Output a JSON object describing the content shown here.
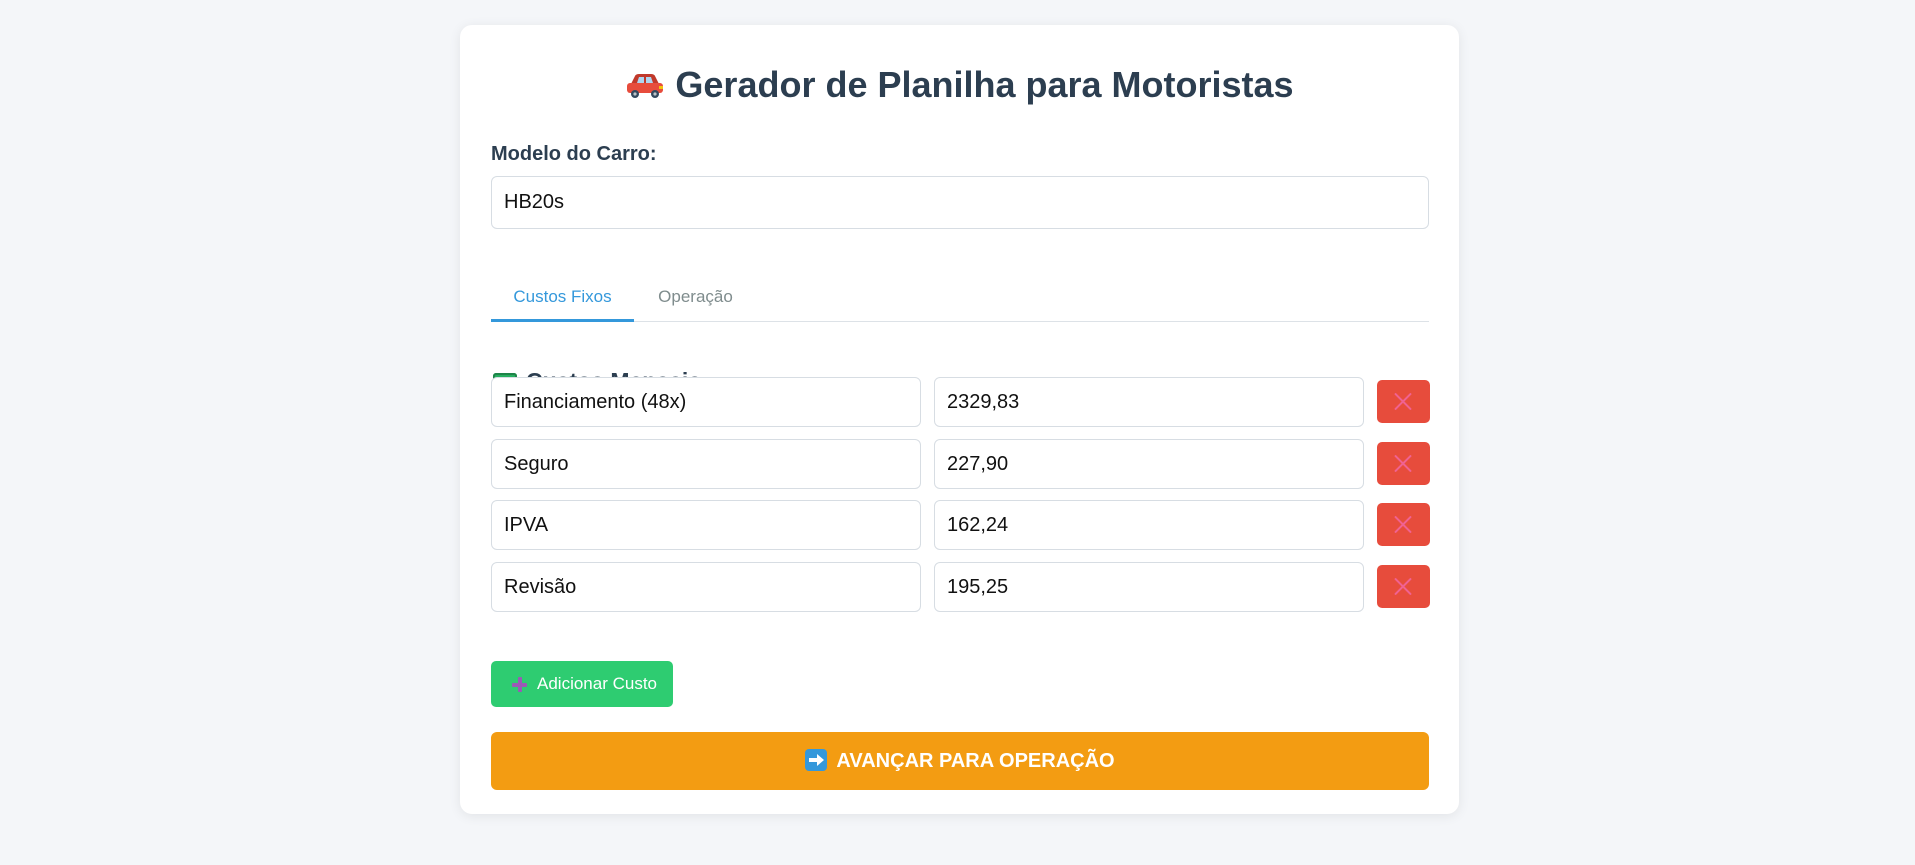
{
  "header": {
    "title": "Gerador de Planilha para Motoristas",
    "title_icon": "car-icon"
  },
  "car": {
    "label": "Modelo do Carro:",
    "value": "HB20s"
  },
  "tabs": [
    {
      "label": "Custos Fixos",
      "active": true
    },
    {
      "label": "Operação",
      "active": false
    }
  ],
  "section": {
    "title": "Custos Mensais",
    "icon": "money-icon"
  },
  "costs": [
    {
      "name": "Financiamento (48x)",
      "value": "2329,83"
    },
    {
      "name": "Seguro",
      "value": "227,90"
    },
    {
      "name": "IPVA",
      "value": "162,24"
    },
    {
      "name": "Revisão",
      "value": "195,25"
    }
  ],
  "actions": {
    "add_label": "Adicionar Custo",
    "advance_label": "AVANÇAR PARA OPERAÇÃO"
  },
  "colors": {
    "accent": "#3498db",
    "delete": "#e74c3c",
    "add": "#2ecc71",
    "advance": "#f39c12",
    "text": "#2c3e50"
  }
}
